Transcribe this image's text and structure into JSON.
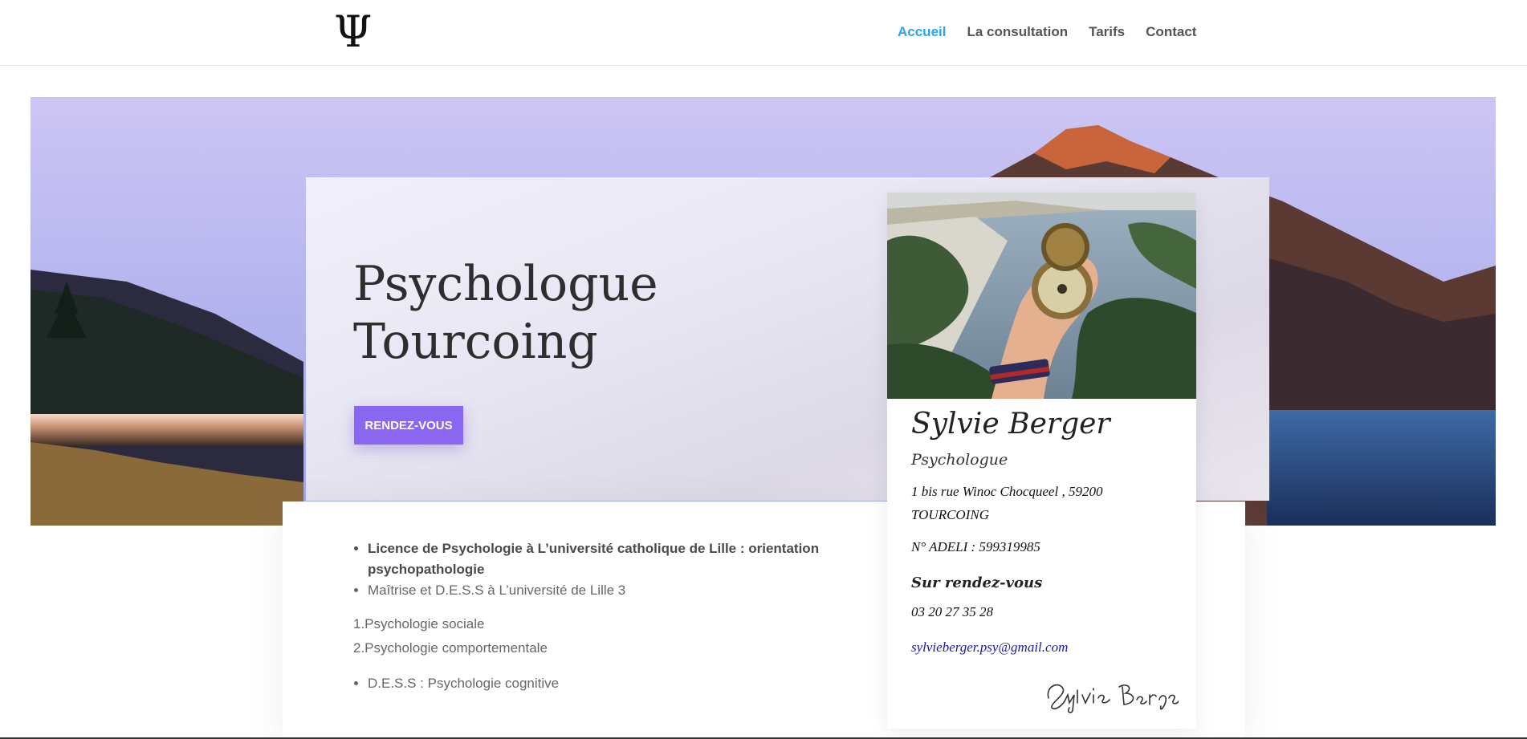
{
  "header": {
    "logo_glyph": "Ψ",
    "nav": [
      {
        "label": "Accueil",
        "active": true
      },
      {
        "label": "La consultation",
        "active": false
      },
      {
        "label": "Tarifs",
        "active": false
      },
      {
        "label": "Contact",
        "active": false
      }
    ],
    "accent_color": "#2ea3f2"
  },
  "hero": {
    "title_line1": "Psychologue",
    "title_line2": "Tourcoing",
    "button_label": "RENDEZ-VOUS",
    "button_color": "#8b66f1"
  },
  "education": {
    "bullets_top": [
      "Licence de Psychologie à L’université catholique de Lille : orientation psychopathologie",
      "Maîtrise et D.E.S.S à L’université de Lille 3"
    ],
    "numbered": [
      "1.Psychologie sociale",
      "2.Psychologie comportementale"
    ],
    "bullets_bottom": [
      "D.E.S.S : Psychologie cognitive"
    ]
  },
  "profile": {
    "name": "Sylvie Berger",
    "role": "Psychologue",
    "address_line1": "1 bis rue Winoc Chocqueel  , 59200",
    "address_line2": "TOURCOING",
    "adeli": "N° ADELI : 599319985",
    "rdv_heading": "Sur rendez-vous",
    "phone": "03 20 27 35 28",
    "email": "sylvieberger.psy@gmail.com",
    "signature": "Sylvie Berger"
  }
}
